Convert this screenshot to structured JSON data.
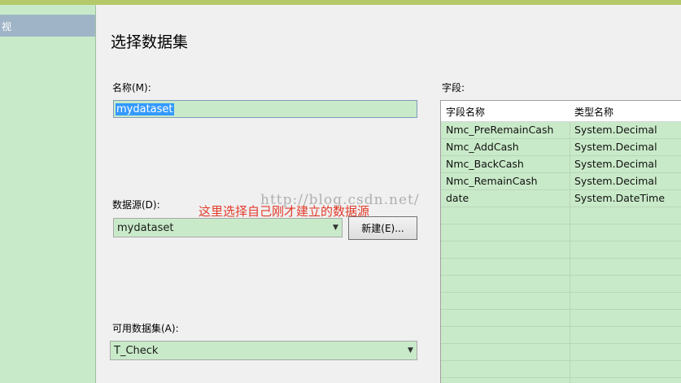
{
  "nav": {
    "selected_label": "视"
  },
  "page_title": "选择数据集",
  "name_field": {
    "label": "名称(M):",
    "value": "mydataset"
  },
  "datasource": {
    "label": "数据源(D):",
    "value": "mydataset",
    "new_button": "新建(E)..."
  },
  "annotation": "这里选择自己刚才建立的数据源",
  "watermark": "http://blog.csdn.net/",
  "available_dataset": {
    "label": "可用数据集(A):",
    "value": "T_Check"
  },
  "fields": {
    "label": "字段:",
    "columns": [
      "字段名称",
      "类型名称"
    ],
    "rows": [
      [
        "Nmc_PreRemainCash",
        "System.Decimal"
      ],
      [
        "Nmc_AddCash",
        "System.Decimal"
      ],
      [
        "Nmc_BackCash",
        "System.Decimal"
      ],
      [
        "Nmc_RemainCash",
        "System.Decimal"
      ],
      [
        "date",
        "System.DateTime"
      ]
    ]
  },
  "colors": {
    "pane_green": "#c9eac9",
    "annotation_red": "#e33a2a",
    "selection_blue": "#3399ff"
  },
  "icons": {
    "combo_arrow": "chevron-down-icon"
  }
}
